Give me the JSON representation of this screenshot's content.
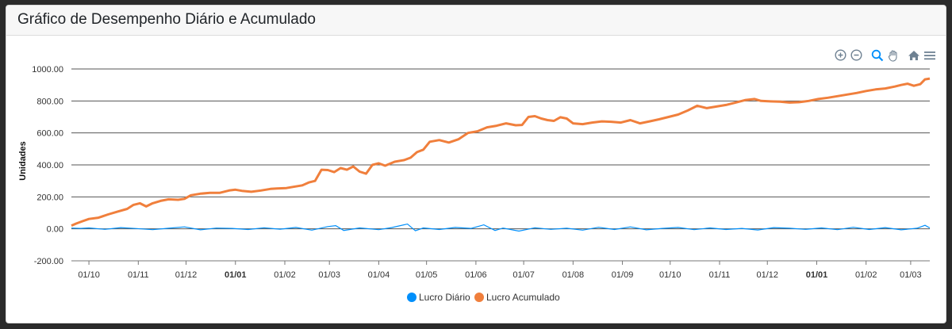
{
  "card": {
    "title": "Gráfico de Desempenho Diário e Acumulado"
  },
  "toolbar": {
    "icons": [
      "zoom-in-icon",
      "zoom-out-icon",
      "zoom-selection-icon",
      "pan-hand-icon",
      "reset-home-icon",
      "menu-icon"
    ],
    "accent_color": "#6e8192",
    "active_color": "#008ffb"
  },
  "chart_data": {
    "type": "line",
    "title": "",
    "xlabel": "",
    "ylabel": "Unidades",
    "ylim": [
      -200,
      1000
    ],
    "yticks": [
      "1000.00",
      "800.00",
      "600.00",
      "400.00",
      "200.00",
      "0.00",
      "-200.00"
    ],
    "yticks_values": [
      1000,
      800,
      600,
      400,
      200,
      0,
      -200
    ],
    "xticks": [
      {
        "label": "01/10",
        "bold": false,
        "day": 0
      },
      {
        "label": "01/11",
        "bold": false,
        "day": 31
      },
      {
        "label": "01/12",
        "bold": false,
        "day": 61
      },
      {
        "label": "01/01",
        "bold": true,
        "day": 92
      },
      {
        "label": "01/02",
        "bold": false,
        "day": 123
      },
      {
        "label": "01/03",
        "bold": false,
        "day": 151
      },
      {
        "label": "01/04",
        "bold": false,
        "day": 182
      },
      {
        "label": "01/05",
        "bold": false,
        "day": 212
      },
      {
        "label": "01/06",
        "bold": false,
        "day": 243
      },
      {
        "label": "01/07",
        "bold": false,
        "day": 273
      },
      {
        "label": "01/08",
        "bold": false,
        "day": 304
      },
      {
        "label": "01/09",
        "bold": false,
        "day": 335
      },
      {
        "label": "01/10",
        "bold": false,
        "day": 365
      },
      {
        "label": "01/11",
        "bold": false,
        "day": 396
      },
      {
        "label": "01/12",
        "bold": false,
        "day": 426
      },
      {
        "label": "01/01",
        "bold": true,
        "day": 457
      },
      {
        "label": "01/02",
        "bold": false,
        "day": 488
      },
      {
        "label": "01/03",
        "bold": false,
        "day": 516
      }
    ],
    "xlim_days": [
      -11,
      528
    ],
    "grid": true,
    "legend_position": "bottom",
    "series": [
      {
        "name": "Lucro Diário",
        "color": "#008ffb",
        "points": [
          [
            -11,
            5
          ],
          [
            -5,
            3
          ],
          [
            0,
            6
          ],
          [
            10,
            -3
          ],
          [
            20,
            8
          ],
          [
            30,
            2
          ],
          [
            40,
            -5
          ],
          [
            50,
            4
          ],
          [
            60,
            12
          ],
          [
            70,
            -6
          ],
          [
            80,
            5
          ],
          [
            90,
            3
          ],
          [
            100,
            -4
          ],
          [
            110,
            7
          ],
          [
            120,
            -2
          ],
          [
            130,
            9
          ],
          [
            140,
            -8
          ],
          [
            150,
            14
          ],
          [
            155,
            20
          ],
          [
            160,
            -10
          ],
          [
            170,
            6
          ],
          [
            182,
            -5
          ],
          [
            190,
            8
          ],
          [
            200,
            30
          ],
          [
            205,
            -12
          ],
          [
            210,
            6
          ],
          [
            220,
            -4
          ],
          [
            230,
            9
          ],
          [
            240,
            3
          ],
          [
            248,
            25
          ],
          [
            255,
            -10
          ],
          [
            260,
            5
          ],
          [
            270,
            -14
          ],
          [
            280,
            7
          ],
          [
            290,
            -3
          ],
          [
            300,
            4
          ],
          [
            310,
            -8
          ],
          [
            320,
            10
          ],
          [
            330,
            -4
          ],
          [
            340,
            12
          ],
          [
            350,
            -6
          ],
          [
            360,
            3
          ],
          [
            370,
            9
          ],
          [
            380,
            -5
          ],
          [
            390,
            6
          ],
          [
            400,
            -4
          ],
          [
            410,
            3
          ],
          [
            420,
            -7
          ],
          [
            430,
            8
          ],
          [
            440,
            4
          ],
          [
            450,
            -3
          ],
          [
            460,
            6
          ],
          [
            470,
            -5
          ],
          [
            480,
            10
          ],
          [
            490,
            -4
          ],
          [
            500,
            8
          ],
          [
            510,
            -6
          ],
          [
            520,
            4
          ],
          [
            525,
            22
          ],
          [
            528,
            6
          ]
        ]
      },
      {
        "name": "Lucro Acumulado",
        "color": "#f07f3c",
        "points": [
          [
            -11,
            20
          ],
          [
            -8,
            33
          ],
          [
            -4,
            48
          ],
          [
            0,
            62
          ],
          [
            6,
            70
          ],
          [
            12,
            90
          ],
          [
            18,
            108
          ],
          [
            24,
            125
          ],
          [
            28,
            150
          ],
          [
            32,
            160
          ],
          [
            36,
            140
          ],
          [
            40,
            160
          ],
          [
            45,
            175
          ],
          [
            50,
            185
          ],
          [
            56,
            182
          ],
          [
            60,
            188
          ],
          [
            64,
            210
          ],
          [
            70,
            220
          ],
          [
            76,
            225
          ],
          [
            82,
            225
          ],
          [
            88,
            240
          ],
          [
            92,
            245
          ],
          [
            96,
            238
          ],
          [
            102,
            232
          ],
          [
            108,
            240
          ],
          [
            114,
            250
          ],
          [
            118,
            252
          ],
          [
            124,
            255
          ],
          [
            128,
            262
          ],
          [
            134,
            272
          ],
          [
            138,
            290
          ],
          [
            142,
            300
          ],
          [
            146,
            370
          ],
          [
            150,
            368
          ],
          [
            154,
            355
          ],
          [
            158,
            380
          ],
          [
            162,
            370
          ],
          [
            166,
            390
          ],
          [
            170,
            358
          ],
          [
            174,
            345
          ],
          [
            178,
            400
          ],
          [
            182,
            410
          ],
          [
            186,
            395
          ],
          [
            192,
            420
          ],
          [
            198,
            430
          ],
          [
            202,
            445
          ],
          [
            206,
            480
          ],
          [
            210,
            495
          ],
          [
            214,
            545
          ],
          [
            220,
            555
          ],
          [
            226,
            540
          ],
          [
            232,
            560
          ],
          [
            238,
            600
          ],
          [
            244,
            610
          ],
          [
            250,
            635
          ],
          [
            256,
            645
          ],
          [
            262,
            660
          ],
          [
            268,
            648
          ],
          [
            272,
            650
          ],
          [
            276,
            700
          ],
          [
            280,
            705
          ],
          [
            284,
            690
          ],
          [
            288,
            680
          ],
          [
            292,
            675
          ],
          [
            296,
            698
          ],
          [
            300,
            690
          ],
          [
            304,
            660
          ],
          [
            310,
            655
          ],
          [
            316,
            665
          ],
          [
            322,
            672
          ],
          [
            328,
            670
          ],
          [
            334,
            665
          ],
          [
            340,
            680
          ],
          [
            346,
            660
          ],
          [
            352,
            672
          ],
          [
            358,
            685
          ],
          [
            364,
            700
          ],
          [
            370,
            715
          ],
          [
            376,
            740
          ],
          [
            382,
            770
          ],
          [
            388,
            755
          ],
          [
            394,
            765
          ],
          [
            400,
            775
          ],
          [
            406,
            790
          ],
          [
            412,
            805
          ],
          [
            418,
            812
          ],
          [
            422,
            800
          ],
          [
            428,
            797
          ],
          [
            434,
            795
          ],
          [
            440,
            790
          ],
          [
            446,
            792
          ],
          [
            452,
            800
          ],
          [
            458,
            812
          ],
          [
            464,
            820
          ],
          [
            470,
            830
          ],
          [
            476,
            840
          ],
          [
            482,
            850
          ],
          [
            488,
            862
          ],
          [
            494,
            872
          ],
          [
            500,
            878
          ],
          [
            506,
            890
          ],
          [
            510,
            900
          ],
          [
            514,
            908
          ],
          [
            518,
            895
          ],
          [
            522,
            905
          ],
          [
            525,
            935
          ],
          [
            528,
            940
          ]
        ]
      }
    ]
  }
}
